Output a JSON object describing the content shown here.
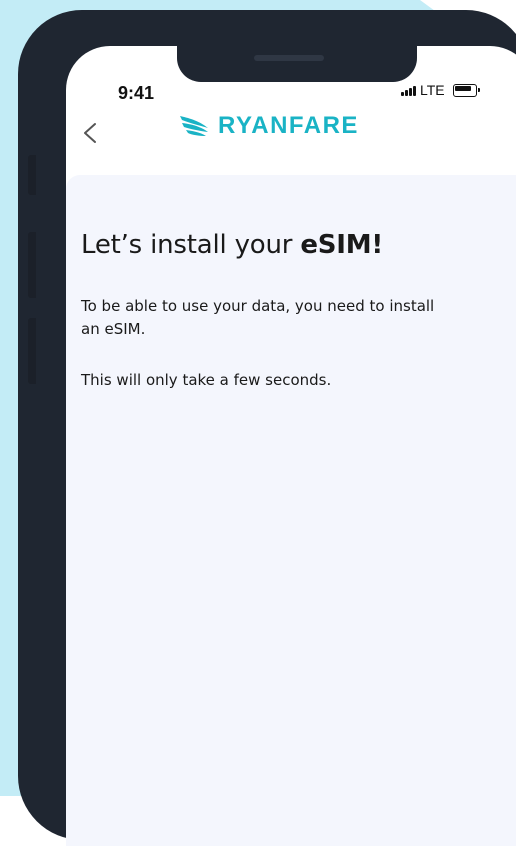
{
  "status_bar": {
    "time": "9:41",
    "network": "LTE"
  },
  "header": {
    "back_icon": "chevron-left-icon",
    "brand_name": "RYANFARE",
    "brand_icon": "wing-logo-icon"
  },
  "main": {
    "title_prefix": "Let’s install your ",
    "title_emphasis": "eSIM!",
    "paragraph_1": "To be able to use your data, you need to install an eSIM.",
    "paragraph_2": "This will only take a few seconds."
  },
  "colors": {
    "brand": "#1ab3c5",
    "background_tint": "#c3ecf6",
    "phone_frame": "#1f2631",
    "content_bg": "#f4f6fd"
  }
}
